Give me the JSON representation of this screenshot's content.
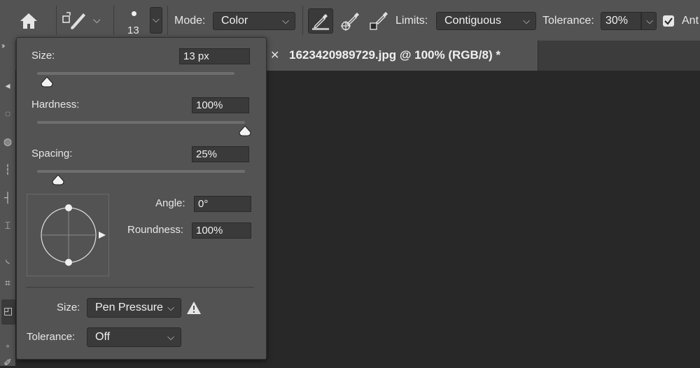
{
  "optionsbar": {
    "brush_size": "13",
    "mode_label": "Mode:",
    "mode_value": "Color",
    "limits_label": "Limits:",
    "limits_value": "Contiguous",
    "tolerance_label": "Tolerance:",
    "tolerance_value": "30%",
    "antialias_label": "Ant"
  },
  "document": {
    "tab_title": "1623420989729.jpg @ 100% (RGB/8) *"
  },
  "popover": {
    "size_label": "Size:",
    "size_value": "13 px",
    "size_slider": 0.05,
    "hardness_label": "Hardness:",
    "hardness_value": "100%",
    "hardness_slider": 1.0,
    "spacing_label": "Spacing:",
    "spacing_value": "25%",
    "spacing_slider": 0.1,
    "angle_label": "Angle:",
    "angle_value": "0°",
    "roundness_label": "Roundness:",
    "roundness_value": "100%",
    "size_control_label": "Size:",
    "size_control_value": "Pen Pressure",
    "tolerance_control_label": "Tolerance:",
    "tolerance_control_value": "Off"
  },
  "icons": {
    "home": "home-icon",
    "tool_preset": "color-replacement-brush-icon",
    "sample_continuous": "eyedropper-continuous-icon",
    "sample_once": "eyedropper-once-icon",
    "sample_swatch": "eyedropper-background-icon",
    "warning": "warning-icon"
  }
}
